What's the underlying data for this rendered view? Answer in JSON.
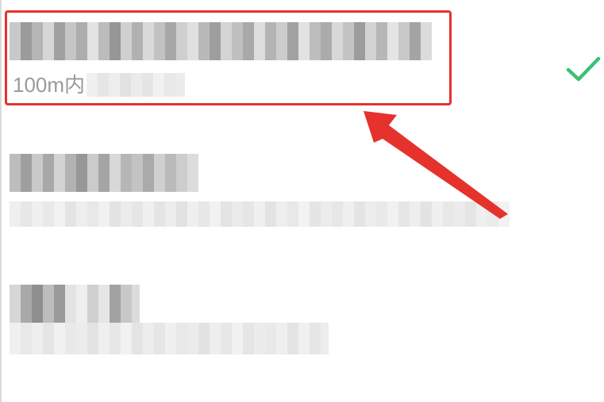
{
  "places": [
    {
      "name": "",
      "distance_label": "100m内",
      "address": "",
      "selected": true
    },
    {
      "name": "",
      "address": "",
      "selected": false
    },
    {
      "name": "",
      "address": "",
      "selected": false
    }
  ],
  "icons": {
    "selected": "checkmark-icon"
  },
  "colors": {
    "check": "#3dbf75",
    "annotation": "#e5322d",
    "distance_text": "#9a9a9a",
    "blur_dark": "#8f8f8f",
    "blur_light": "#e6e6e6"
  }
}
